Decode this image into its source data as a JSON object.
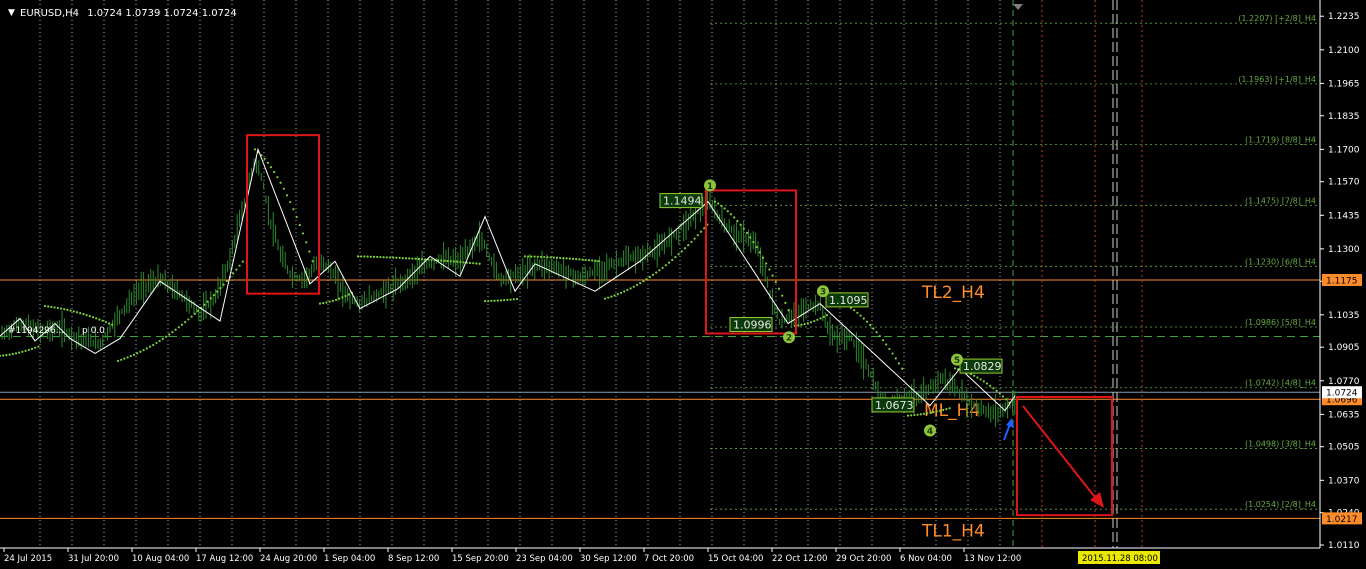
{
  "header": {
    "symbol": "EURUSD,H4",
    "quote": "1.0724 1.0739 1.0724 1.0724"
  },
  "colors": {
    "background": "#000000",
    "grid": "#ffffff",
    "axis_text": "#ffffff",
    "candles": "#2e8b2e",
    "psar": "#7dd33a",
    "zigzag": "#ffffff",
    "red_box": "#e01515",
    "trendline": "#ff8c2a",
    "murrey": "#66aa44",
    "label_box_fill": "#0b3a0b",
    "label_box_text": "#e6e6e6",
    "circle_fill": "#8fc43a",
    "blue_arrow": "#2060ff"
  },
  "indicator_text": "#1194296...",
  "indicator_text2": "p 0.0",
  "chart_data": {
    "type": "line",
    "title": "",
    "xlabel": "",
    "ylabel": "",
    "ylim": [
      1.0098,
      1.2268
    ],
    "y_ticks": [
      "1.2235",
      "1.2100",
      "1.1965",
      "1.1835",
      "1.1700",
      "1.1570",
      "1.1435",
      "1.1300",
      "1.1170",
      "1.1035",
      "1.0905",
      "1.0770",
      "1.0635",
      "1.0505",
      "1.0370",
      "1.0240",
      "1.0110"
    ],
    "x_ticks": [
      "24 Jul 2015",
      "31 Jul 20:00",
      "10 Aug 04:00",
      "17 Aug 12:00",
      "24 Aug 20:00",
      "1 Sep 04:00",
      "8 Sep 12:00",
      "15 Sep 20:00",
      "23 Sep 04:00",
      "30 Sep 12:00",
      "7 Oct 20:00",
      "15 Oct 04:00",
      "22 Oct 12:00",
      "29 Oct 20:00",
      "6 Nov 04:00",
      "13 Nov 12:00"
    ],
    "x_range": [
      0,
      1320
    ],
    "price_series": {
      "name": "",
      "x": [
        0,
        20,
        40,
        60,
        80,
        100,
        120,
        140,
        160,
        180,
        200,
        215,
        230,
        245,
        255,
        262,
        270,
        280,
        290,
        300,
        310,
        320,
        330,
        340,
        350,
        360,
        380,
        400,
        420,
        440,
        460,
        480,
        500,
        520,
        540,
        560,
        580,
        600,
        620,
        640,
        660,
        680,
        700,
        710,
        720,
        730,
        740,
        750,
        760,
        770,
        780,
        790,
        800,
        810,
        820,
        830,
        840,
        850,
        860,
        870,
        880,
        890,
        900,
        910,
        920,
        930,
        940,
        950,
        960,
        970,
        980,
        990,
        1000,
        1010,
        1018
      ],
      "values": [
        1.095,
        1.1,
        1.097,
        1.098,
        1.094,
        1.092,
        1.104,
        1.114,
        1.118,
        1.112,
        1.104,
        1.11,
        1.126,
        1.15,
        1.166,
        1.158,
        1.142,
        1.128,
        1.12,
        1.118,
        1.12,
        1.126,
        1.122,
        1.115,
        1.11,
        1.108,
        1.112,
        1.116,
        1.122,
        1.126,
        1.125,
        1.135,
        1.118,
        1.12,
        1.124,
        1.122,
        1.118,
        1.122,
        1.125,
        1.127,
        1.13,
        1.138,
        1.146,
        1.149,
        1.142,
        1.138,
        1.135,
        1.134,
        1.128,
        1.112,
        1.1,
        1.103,
        1.105,
        1.107,
        1.108,
        1.096,
        1.094,
        1.095,
        1.088,
        1.08,
        1.07,
        1.068,
        1.07,
        1.072,
        1.07,
        1.074,
        1.078,
        1.076,
        1.072,
        1.068,
        1.066,
        1.064,
        1.065,
        1.067,
        1.072
      ]
    },
    "psar": {
      "name": "",
      "segments": [
        {
          "x": [
            0,
            40
          ],
          "y": [
            1.087,
            1.091
          ]
        },
        {
          "x": [
            45,
            115
          ],
          "y": [
            1.107,
            1.099
          ]
        },
        {
          "x": [
            118,
            245
          ],
          "y": [
            1.085,
            1.126
          ]
        },
        {
          "x": [
            255,
            315
          ],
          "y": [
            1.17,
            1.122
          ]
        },
        {
          "x": [
            320,
            355
          ],
          "y": [
            1.108,
            1.113
          ]
        },
        {
          "x": [
            358,
            480
          ],
          "y": [
            1.127,
            1.124
          ]
        },
        {
          "x": [
            485,
            520
          ],
          "y": [
            1.109,
            1.11
          ]
        },
        {
          "x": [
            525,
            600
          ],
          "y": [
            1.127,
            1.125
          ]
        },
        {
          "x": [
            605,
            710
          ],
          "y": [
            1.11,
            1.141
          ]
        },
        {
          "x": [
            715,
            790
          ],
          "y": [
            1.149,
            1.104
          ]
        },
        {
          "x": [
            795,
            830
          ],
          "y": [
            1.099,
            1.104
          ]
        },
        {
          "x": [
            835,
            905
          ],
          "y": [
            1.11,
            1.08
          ]
        },
        {
          "x": [
            908,
            950
          ],
          "y": [
            1.063,
            1.066
          ]
        },
        {
          "x": [
            955,
            1010
          ],
          "y": [
            1.082,
            1.068
          ]
        }
      ]
    },
    "zigzag": {
      "name": "",
      "x": [
        0,
        20,
        35,
        55,
        70,
        95,
        120,
        160,
        220,
        258,
        310,
        335,
        360,
        398,
        430,
        460,
        485,
        515,
        535,
        595,
        640,
        708,
        788,
        820,
        930,
        960,
        1005,
        1015
      ],
      "y": [
        1.095,
        1.102,
        1.093,
        1.1,
        1.094,
        1.088,
        1.094,
        1.117,
        1.101,
        1.17,
        1.116,
        1.125,
        1.106,
        1.114,
        1.127,
        1.119,
        1.143,
        1.113,
        1.124,
        1.113,
        1.125,
        1.149,
        1.1,
        1.108,
        1.067,
        1.082,
        1.065,
        1.071
      ]
    },
    "murrey_lines": [
      {
        "label": "(1.2207) [+2/8]_H4",
        "value": 1.2207
      },
      {
        "label": "(1.1963) [+1/8]_H4",
        "value": 1.1963
      },
      {
        "label": "(1.1719) [8/8]_H4",
        "value": 1.1719
      },
      {
        "label": "(1.1475) [7/8]_H4",
        "value": 1.1475
      },
      {
        "label": "(1.1230) [6/8]_H4",
        "value": 1.123
      },
      {
        "label": "(1.0986) [5/8]_H4",
        "value": 1.0986
      },
      {
        "label": "(1.0742) [4/8]_H4",
        "value": 1.0742
      },
      {
        "label": "(1.0498) [3/8]_H4",
        "value": 1.0498
      },
      {
        "label": "(1.0254) [2/8]_H4",
        "value": 1.0254
      }
    ],
    "horizontal_lines": [
      {
        "label": "1.1175",
        "value": 1.1175,
        "name": "TL2_H4"
      },
      {
        "label": "1.0696",
        "value": 1.0696,
        "name": "ML_H4"
      },
      {
        "label": "1.0217",
        "value": 1.0217,
        "name": "TL1_H4"
      }
    ],
    "current_price": {
      "label": "1.0724",
      "value": 1.0724
    },
    "dashed_level": 1.0948,
    "price_labels": [
      {
        "text": "1.1494",
        "x": 690,
        "y": 1.1494
      },
      {
        "text": "1.0996",
        "x": 760,
        "y": 1.0996
      },
      {
        "text": "1.1095",
        "x": 856,
        "y": 1.1095
      },
      {
        "text": "1.0829",
        "x": 990,
        "y": 1.0829
      },
      {
        "text": "1.0673",
        "x": 902,
        "y": 1.0673
      }
    ],
    "wave_points": [
      {
        "text": "1",
        "x": 710,
        "y": 1.1555
      },
      {
        "text": "2",
        "x": 789,
        "y": 1.0945
      },
      {
        "text": "3",
        "x": 823,
        "y": 1.113
      },
      {
        "text": "4",
        "x": 930,
        "y": 1.057
      },
      {
        "text": "5",
        "x": 957,
        "y": 1.0855
      }
    ],
    "red_boxes": [
      {
        "x0": 247,
        "x1": 319,
        "y0": 1.1757,
        "y1": 1.112
      },
      {
        "x0": 706,
        "x1": 796,
        "y0": 1.1535,
        "y1": 1.096
      },
      {
        "x0": 1017,
        "x1": 1112,
        "y0": 1.0705,
        "y1": 1.023
      }
    ],
    "vertical_lines": [
      {
        "x": 1013,
        "style": "dash-green"
      },
      {
        "x": 1042,
        "style": "dot-red"
      },
      {
        "x": 1095,
        "style": "dot-red"
      },
      {
        "x": 1113,
        "style": "dash-white"
      },
      {
        "x": 1117,
        "style": "dash-white"
      },
      {
        "x": 1142,
        "style": "dot-red"
      }
    ],
    "highlight_date": "2015.11.28 08:00"
  }
}
